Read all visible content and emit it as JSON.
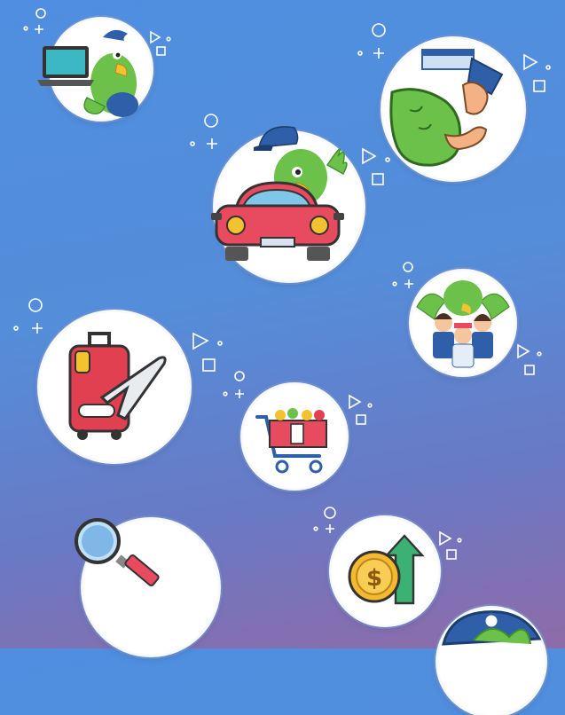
{
  "colors": {
    "background_top": "#4f8ee0",
    "background_bottom": "#8f6ba8",
    "parrot_green": "#6cc14a",
    "parrot_dark_green": "#3f8f2a",
    "cap_blue": "#2f5fa8",
    "beak_yellow": "#f2c230",
    "accent_red": "#e84a5f",
    "luggage_red": "#e0404f",
    "cart_red": "#e84a5f",
    "coin_gold": "#f5b82e",
    "arrow_green": "#3bb273",
    "magnifier_blue": "#7fb8e6"
  },
  "icons": [
    "parrot-laptop-icon",
    "parrot-handshake-icon",
    "parrot-car-icon",
    "parrot-team-icon",
    "luggage-plane-icon",
    "shopping-cart-icon",
    "magnifier-icon",
    "coin-growth-icon",
    "parrot-cap-icon"
  ]
}
